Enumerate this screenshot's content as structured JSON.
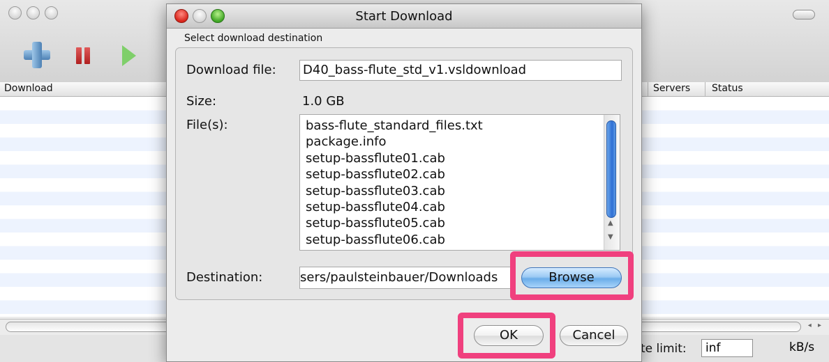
{
  "main_window": {
    "toolbar": {
      "add_icon": "plus-icon",
      "pause_icon": "pause-icon",
      "resume_icon": "play-icon"
    },
    "columns": {
      "download": "Download",
      "servers": "Servers",
      "status": "Status"
    },
    "statusbar": {
      "rate_label": "te limit:",
      "rate_value": "inf",
      "rate_unit": "kB/s"
    }
  },
  "dialog": {
    "title": "Start Download",
    "group_label": "Select download destination",
    "download_file_label": "Download file:",
    "download_file_value": "D40_bass-flute_std_v1.vsldownload",
    "size_label": "Size:",
    "size_value": "1.0 GB",
    "files_label": "File(s):",
    "files": [
      "bass-flute_standard_files.txt",
      "package.info",
      "setup-bassflute01.cab",
      "setup-bassflute02.cab",
      "setup-bassflute03.cab",
      "setup-bassflute04.cab",
      "setup-bassflute05.cab",
      "setup-bassflute06.cab"
    ],
    "destination_label": "Destination:",
    "destination_value": "sers/paulsteinbauer/Downloads",
    "browse_label": "Browse",
    "ok_label": "OK",
    "cancel_label": "Cancel"
  },
  "colors": {
    "highlight": "#f0407e",
    "default_button": "#6bade9"
  }
}
